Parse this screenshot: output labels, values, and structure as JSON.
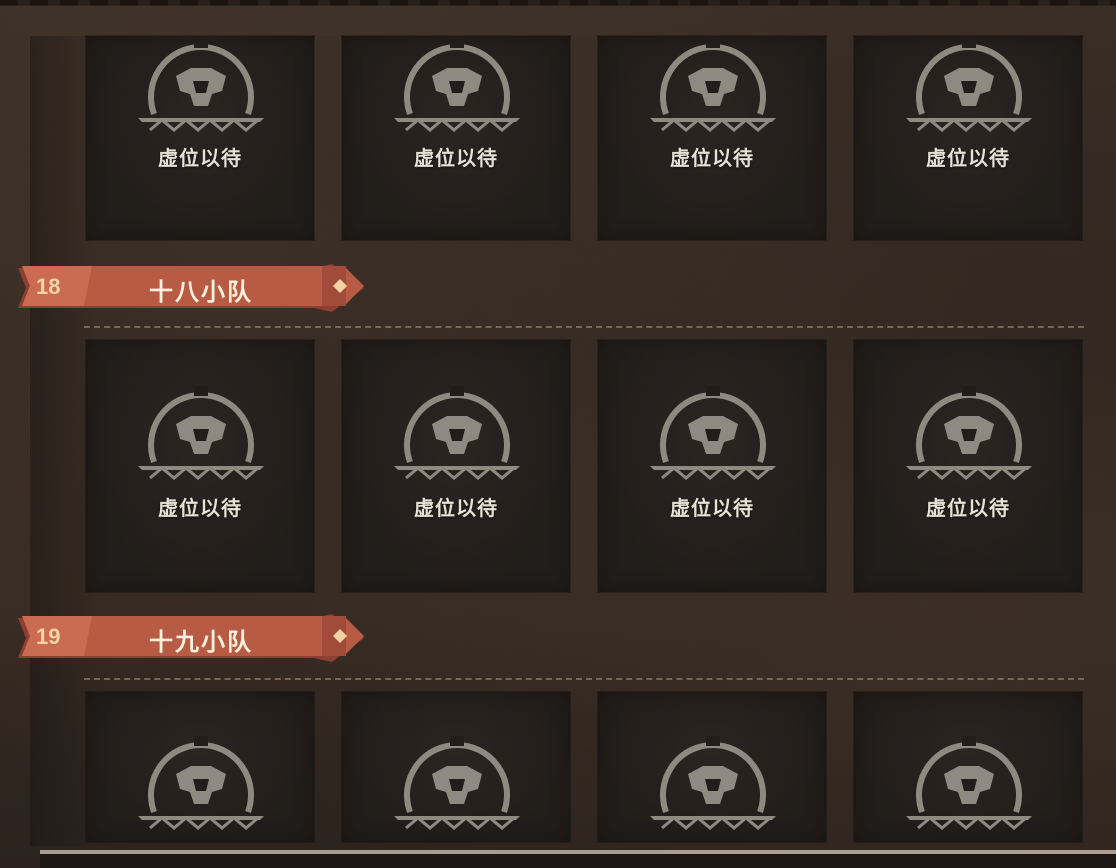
{
  "slot_label": "虚位以待",
  "squads": [
    {
      "number": "18",
      "name": "十八小队"
    },
    {
      "number": "19",
      "name": "十九小队"
    }
  ],
  "colors": {
    "banner": "#b75b45",
    "banner_dark": "#8e3f31",
    "number_text": "#f2d3a6",
    "slot_bg": "#211d1a",
    "emblem": "#8f8a81"
  },
  "icons": [
    "lion-emblem-icon",
    "diamond-ornament-icon"
  ]
}
